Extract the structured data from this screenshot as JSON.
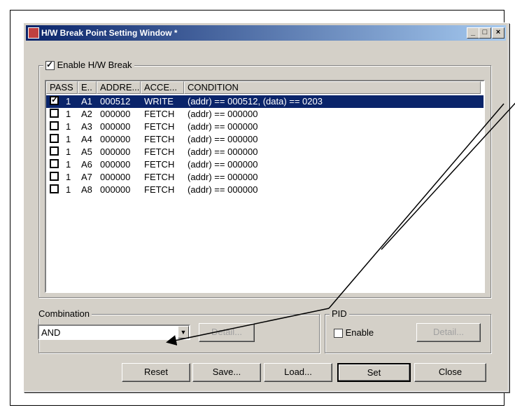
{
  "window": {
    "title": "H/W Break Point Setting Window *",
    "minimize": "_",
    "maximize": "□",
    "close": "×"
  },
  "enable_hw_break": {
    "label": "Enable H/W Break",
    "checked": true
  },
  "table": {
    "headers": [
      "PASS",
      "E..",
      "ADDRE...",
      "ACCE...",
      "CONDITION"
    ],
    "rows": [
      {
        "checked": true,
        "pass": "1",
        "event": "A1",
        "address": "000512",
        "access": "WRITE",
        "condition": "(addr) == 000512, (data) == 0203",
        "selected": true
      },
      {
        "checked": false,
        "pass": "1",
        "event": "A2",
        "address": "000000",
        "access": "FETCH",
        "condition": "(addr) == 000000"
      },
      {
        "checked": false,
        "pass": "1",
        "event": "A3",
        "address": "000000",
        "access": "FETCH",
        "condition": "(addr) == 000000"
      },
      {
        "checked": false,
        "pass": "1",
        "event": "A4",
        "address": "000000",
        "access": "FETCH",
        "condition": "(addr) == 000000"
      },
      {
        "checked": false,
        "pass": "1",
        "event": "A5",
        "address": "000000",
        "access": "FETCH",
        "condition": "(addr) == 000000"
      },
      {
        "checked": false,
        "pass": "1",
        "event": "A6",
        "address": "000000",
        "access": "FETCH",
        "condition": "(addr) == 000000"
      },
      {
        "checked": false,
        "pass": "1",
        "event": "A7",
        "address": "000000",
        "access": "FETCH",
        "condition": "(addr) == 000000"
      },
      {
        "checked": false,
        "pass": "1",
        "event": "A8",
        "address": "000000",
        "access": "FETCH",
        "condition": "(addr) == 000000"
      }
    ]
  },
  "combination": {
    "legend": "Combination",
    "value": "AND",
    "detail_label": "Detail..."
  },
  "pid": {
    "legend": "PID",
    "enable_label": "Enable",
    "enabled": false,
    "detail_label": "Detail..."
  },
  "buttons": {
    "reset": "Reset",
    "save": "Save...",
    "load": "Load...",
    "set": "Set",
    "close": "Close"
  },
  "colors": {
    "selection": "#0a246a",
    "dialog_face": "#d4d0c8"
  }
}
